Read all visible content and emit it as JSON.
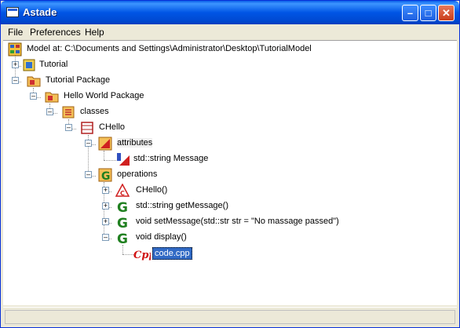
{
  "window": {
    "title": "Astade"
  },
  "menu": {
    "items": [
      "File",
      "Preferences",
      "Help"
    ]
  },
  "tree": {
    "root": "Model at: C:\\Documents and Settings\\Administrator\\Desktop\\TutorialModel",
    "nodes": [
      {
        "label": "Tutorial"
      },
      {
        "label": "Tutorial Package"
      },
      {
        "label": "Hello World Package"
      },
      {
        "label": "classes"
      },
      {
        "label": "CHello"
      },
      {
        "label": "attributes"
      },
      {
        "label": "std::string Message"
      },
      {
        "label": "operations"
      },
      {
        "label": "CHello()"
      },
      {
        "label": "std::string getMessage()"
      },
      {
        "label": "void setMessage(std::str str = \"No massage passed\")"
      },
      {
        "label": "void display()"
      },
      {
        "label": "code.cpp"
      }
    ]
  },
  "colors": {
    "selection": "#316ac5",
    "titlebar": "#0055e5"
  }
}
